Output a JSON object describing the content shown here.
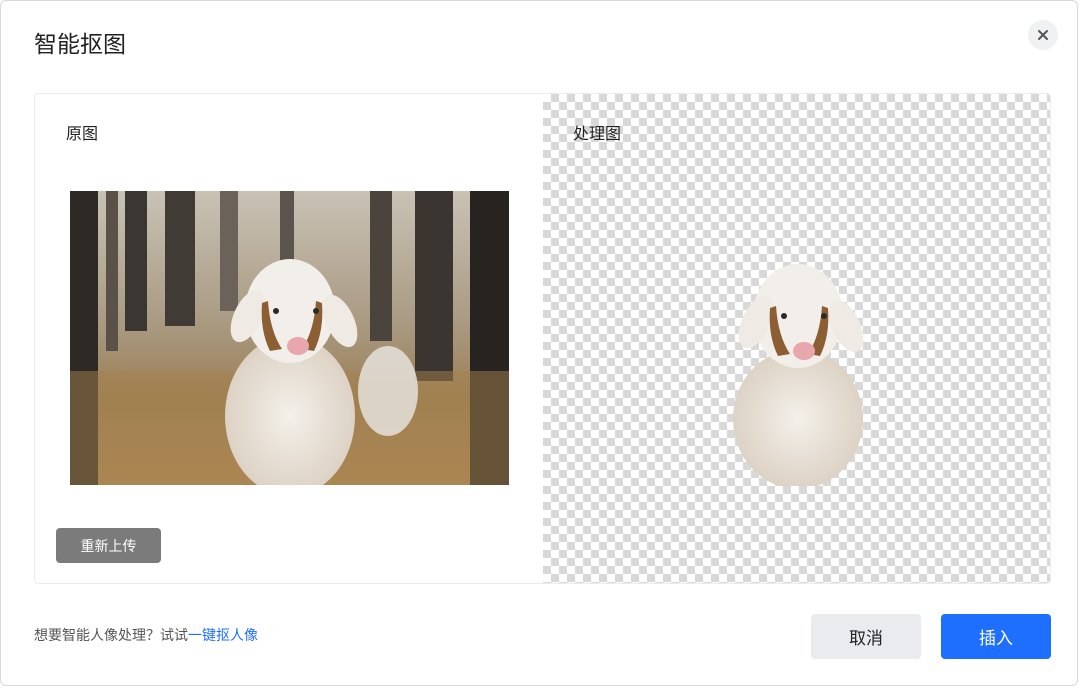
{
  "dialog": {
    "title": "智能抠图",
    "close_icon": "close-icon"
  },
  "original": {
    "label": "原图",
    "image": "sheep-photo",
    "reupload_label": "重新上传"
  },
  "processed": {
    "label": "处理图",
    "image": "sheep-cutout"
  },
  "footer": {
    "hint_text": "想要智能人像处理？试试",
    "hint_link": "一键抠人像",
    "cancel_label": "取消",
    "insert_label": "插入"
  },
  "colors": {
    "primary": "#1f6fff",
    "reupload_bg": "#7b7b7b",
    "cancel_bg": "#e9ebee"
  }
}
